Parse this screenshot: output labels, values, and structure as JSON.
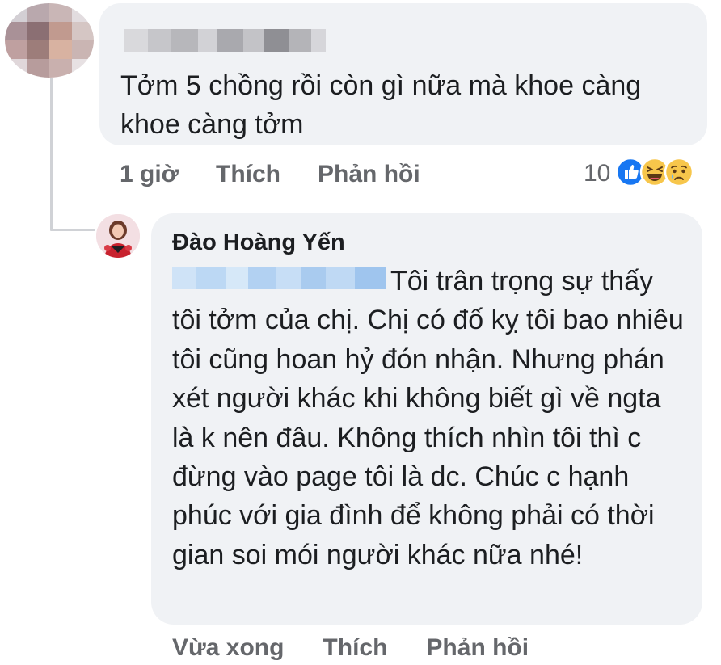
{
  "comment1": {
    "text": "Tởm 5 chồng rồi còn gì nữa mà khoe càng khoe càng tởm",
    "time": "1 giờ",
    "like_label": "Thích",
    "reply_label": "Phản hồi",
    "reaction_count": "10",
    "reactions": [
      "like-icon",
      "haha-icon",
      "sad-icon"
    ]
  },
  "reply": {
    "author": "Đào Hoàng Yến",
    "text": "Tôi trân trọng sự thấy tôi tởm của chị. Chị có đố kỵ tôi bao nhiêu tôi cũng hoan hỷ đón nhận. Nhưng phán xét người khác khi không biết gì về ngta là k nên đâu. Không thích nhìn tôi thì c đừng vào page tôi là dc. Chúc c hạnh phúc với gia đình để không phải có thời gian soi mói người khác nữa nhé!",
    "time": "Vừa xong",
    "like_label": "Thích",
    "reply_label": "Phản hồi"
  },
  "colors": {
    "bubble": "#f0f2f5",
    "meta_text": "#65676b",
    "body_text": "#1c1e21",
    "like_blue": "#1877f2",
    "emoji_yellow": "#f7c64b",
    "thread_line": "#d0d2d6"
  }
}
